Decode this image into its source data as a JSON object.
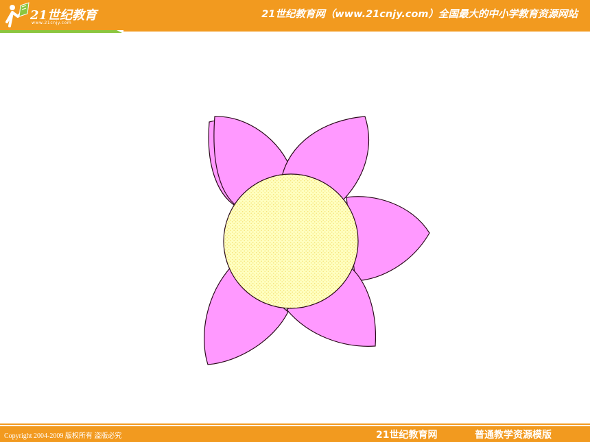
{
  "header": {
    "logo_wordmark": "21世纪教育",
    "logo_url": "www.21cnjy.com",
    "slogan": "21世纪教育网（www.21cnjy.com）全国最大的中小学教育资源网站"
  },
  "slide": {
    "illustration": "flower"
  },
  "footer": {
    "copyright": "Copyright 2004-2009 版权所有 盗版必究",
    "brand": "21世纪教育网",
    "template": "普通教学资源模版"
  },
  "colors": {
    "bar": "#f29a1f",
    "accent_green": "#8cc63f",
    "petal_fill": "#ff99ff",
    "center_fill": "#ffffc0",
    "outline": "#2a0a1a"
  }
}
